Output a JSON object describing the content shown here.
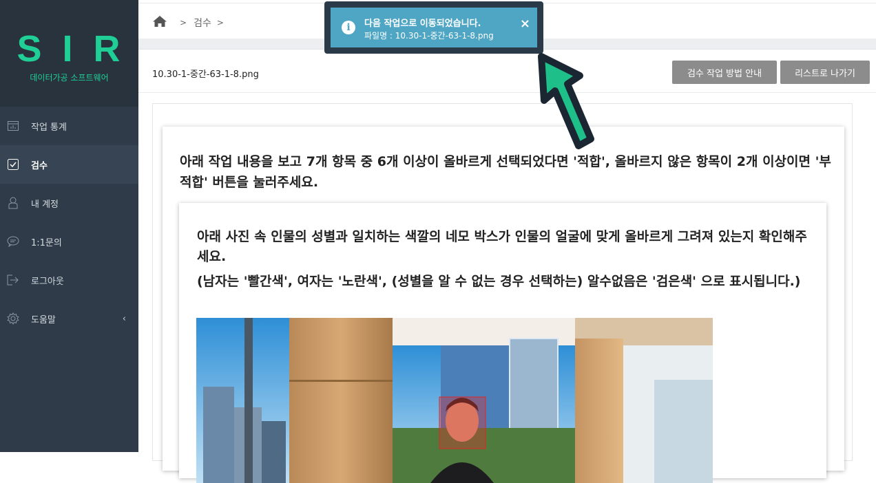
{
  "brand": {
    "logo": "SIR",
    "subtitle": "데이터가공 소프트웨어",
    "color": "#1fcf96"
  },
  "sidebar": {
    "items": [
      {
        "label": "작업 통계",
        "icon": "chart-icon",
        "active": false
      },
      {
        "label": "검수",
        "icon": "checkbox-icon",
        "active": true
      },
      {
        "label": "내 계정",
        "icon": "user-icon",
        "active": false
      },
      {
        "label": "1:1문의",
        "icon": "chat-icon",
        "active": false
      },
      {
        "label": "로그아웃",
        "icon": "logout-icon",
        "active": false
      },
      {
        "label": "도움말",
        "icon": "gear-icon",
        "active": false,
        "expand": "‹"
      }
    ]
  },
  "breadcrumb": {
    "home_icon": "home-icon",
    "separator": ">",
    "items": [
      "검수"
    ]
  },
  "file": {
    "name": "10.30-1-중간-63-1-8.png"
  },
  "buttons": {
    "guide": "검수 작업 방법 안내",
    "list": "리스트로 나가기"
  },
  "task": {
    "instruction": "아래 작업 내용을 보고 7개 항목 중 6개 이상이 올바르게 선택되었다면 '적합', 올바르지 않은 항목이 2개 이상이면 '부적합' 버튼을 눌러주세요.",
    "question": "아래 사진 속 인물의 성별과 일치하는 색깔의 네모 박스가 인물의 얼굴에 맞게 올바르게 그려져 있는지 확인해주세요.",
    "note": "(남자는 '빨간색', 여자는 '노란색', (성별을 알 수 없는 경우 선택하는) 알수없음은 '검은색' 으로 표시됩니다.)"
  },
  "toast": {
    "title": "다음 작업으로 이동되었습니다.",
    "file": "파일명 : 10.30-1-중간-63-1-8.png",
    "close": "×",
    "icon": "info-icon",
    "bg": "#4fa6c4"
  },
  "colors": {
    "sidebar": "#2f3b48",
    "accent": "#1fcf96",
    "button": "#8c8c8c",
    "arrow": "#1fbf8a"
  }
}
